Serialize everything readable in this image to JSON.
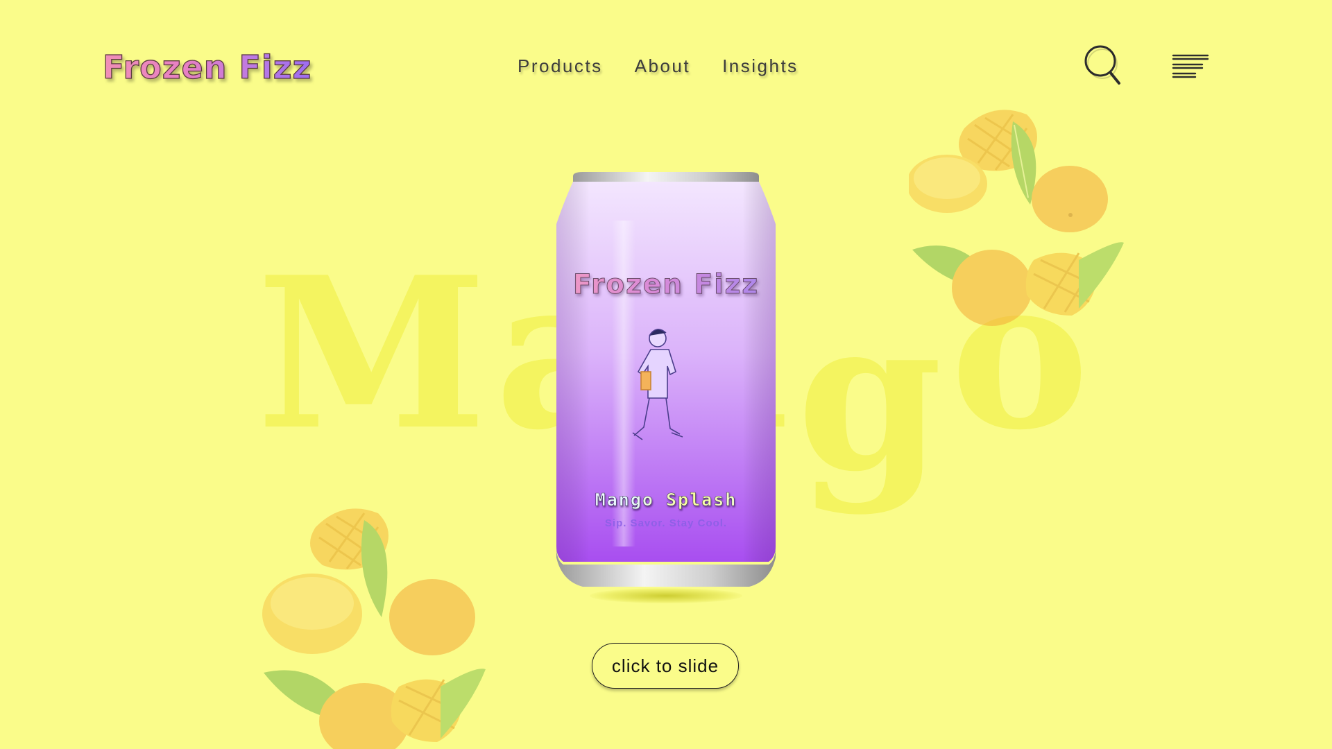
{
  "brand": {
    "logo_text": "Frozen Fizz"
  },
  "nav": {
    "links": [
      "Products",
      "About",
      "Insights"
    ]
  },
  "icons": {
    "search": "search-icon",
    "menu": "menu-icon"
  },
  "hero": {
    "background_word_letters": [
      "M",
      "a",
      "n",
      "g",
      "o"
    ],
    "can": {
      "brand": "Frozen Fizz",
      "flavor": "Mango Splash",
      "tagline": "Sip. Savor. Stay Cool."
    },
    "slide_button_label": "click to slide"
  },
  "colors": {
    "background": "#fafc8a",
    "background_word": "#f4f45e",
    "can_top": "#f1e2fd",
    "can_bottom": "#a74ff0",
    "mango": "#f5b13d"
  }
}
